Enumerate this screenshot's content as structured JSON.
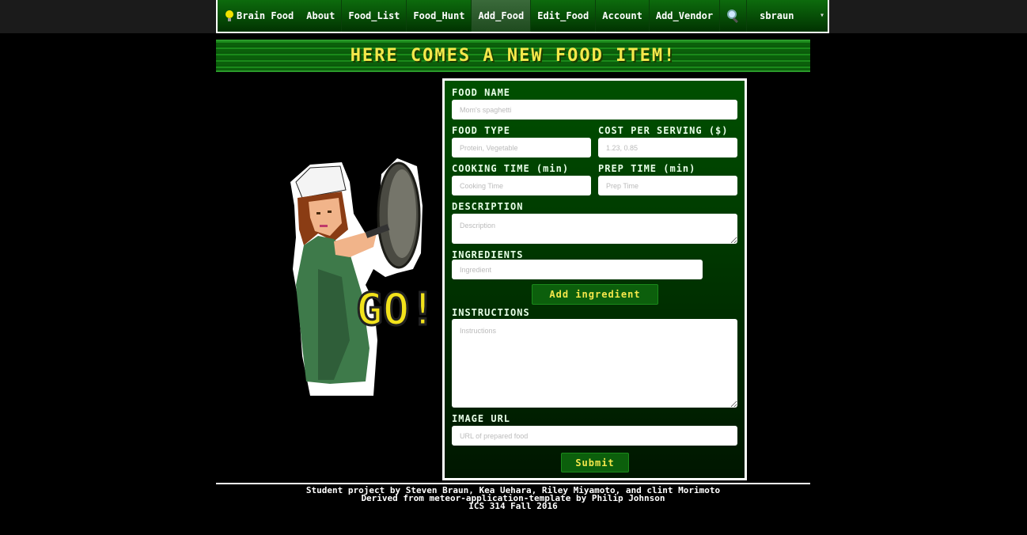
{
  "nav": {
    "brand": "Brain Food",
    "items": [
      "About",
      "Food_List",
      "Food_Hunt",
      "Add_Food",
      "Edit_Food",
      "Account",
      "Add_Vendor"
    ],
    "active": "Add_Food",
    "search_icon": "magnifier-icon",
    "user": "sbraun",
    "caret": "▾"
  },
  "banner": {
    "title": "HERE COMES A NEW FOOD ITEM!"
  },
  "illustration": {
    "caption": "GO!"
  },
  "form": {
    "food_name": {
      "label": "FOOD NAME",
      "placeholder": "Mom's spaghetti"
    },
    "food_type": {
      "label": "FOOD TYPE",
      "placeholder": "Protein, Vegetable"
    },
    "cost": {
      "label": "COST PER SERVING ($)",
      "placeholder": "1.23, 0.85"
    },
    "cooking_time": {
      "label": "COOKING TIME (min)",
      "placeholder": "Cooking Time"
    },
    "prep_time": {
      "label": "PREP TIME (min)",
      "placeholder": "Prep Time"
    },
    "description": {
      "label": "DESCRIPTION",
      "placeholder": "Description"
    },
    "ingredients": {
      "label": "INGREDIENTS",
      "placeholder": "Ingredient"
    },
    "add_ingredient": "Add ingredient",
    "instructions": {
      "label": "INSTRUCTIONS",
      "placeholder": "Instructions"
    },
    "image_url": {
      "label": "IMAGE URL",
      "placeholder": "URL of prepared food"
    },
    "submit": "Submit"
  },
  "footer": {
    "line1": "Student project by Steven Braun, Kea Uehara, Riley Miyamoto, and clint Morimoto",
    "line2": "Derived from meteor-application-template by Philip Johnson",
    "line3": "ICS 314 Fall 2016"
  },
  "colors": {
    "panel_top": "#005000",
    "panel_bottom": "#001600",
    "accent_text": "#f5e84b",
    "nav_bg": "#0d6b0d"
  }
}
